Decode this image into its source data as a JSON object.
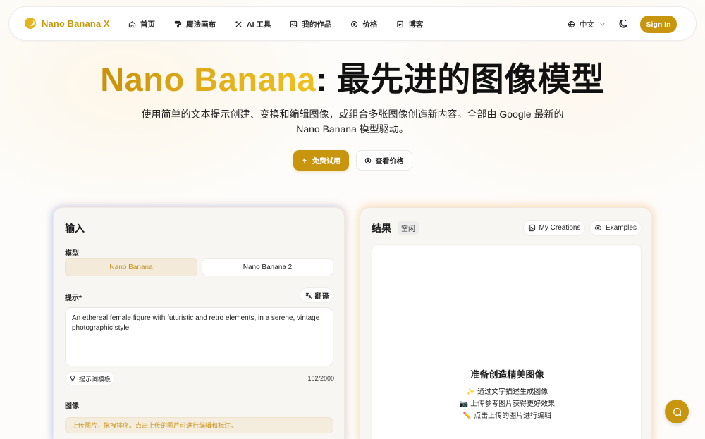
{
  "nav": {
    "brand": "Nano Banana X",
    "items": [
      {
        "label": "首页",
        "icon": "home-icon"
      },
      {
        "label": "魔法画布",
        "icon": "paint-roller-icon"
      },
      {
        "label": "AI 工具",
        "icon": "tools-icon"
      },
      {
        "label": "我的作品",
        "icon": "image-icon"
      },
      {
        "label": "价格",
        "icon": "coin-icon"
      },
      {
        "label": "博客",
        "icon": "document-icon"
      }
    ],
    "language": "中文",
    "signin_label": "Sign In"
  },
  "hero": {
    "title_brand": "Nano Banana",
    "title_rest": ": 最先进的图像模型",
    "subtitle": "使用简单的文本提示创建、变换和编辑图像，或组合多张图像创造新内容。全部由 Google 最新的 Nano Banana 模型驱动。",
    "cta_primary": "免费试用",
    "cta_secondary": "查看价格"
  },
  "input_panel": {
    "title": "输入",
    "model_label": "模型",
    "models": [
      "Nano Banana",
      "Nano Banana 2"
    ],
    "selected_model": "Nano Banana",
    "prompt_label": "提示*",
    "translate_label": "翻译",
    "prompt_value": "An ethereal female figure with futuristic and retro elements, in a serene, vintage photographic style.",
    "template_label": "提示词模板",
    "char_count": "102/2000",
    "image_label": "图像",
    "upload_hint": "上传图片，拖拽排序。点击上传的图片可进行编辑和标注。"
  },
  "result_panel": {
    "title": "结果",
    "status": "空闲",
    "my_creations_label": "My Creations",
    "examples_label": "Examples",
    "ready_title": "准备创造精美图像",
    "tips": [
      "✨ 通过文字描述生成图像",
      "📷 上传参考图片获得更好效果",
      "✏️ 点击上传的图片进行编辑"
    ]
  },
  "colors": {
    "accent": "#c8950f",
    "brand_gradient_start": "#c9900a",
    "brand_gradient_end": "#efc11e"
  }
}
